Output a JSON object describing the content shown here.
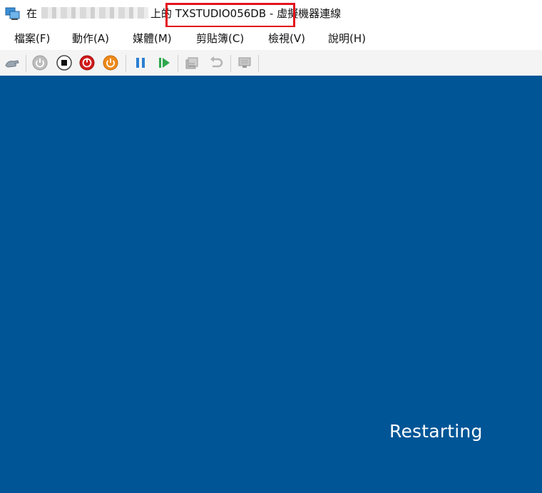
{
  "window": {
    "icon": "vm-connection-icon",
    "title_prefix": "在",
    "title_host": "TXSTUDIOXX RRM",
    "title_suffix": "上的 TXSTUDIO056DB - 虛擬機器連線",
    "vm_name": "TXSTUDIO056DB",
    "highlight_color": "#e3131b"
  },
  "menu": {
    "items": [
      {
        "label": "檔案(F)"
      },
      {
        "label": "動作(A)"
      },
      {
        "label": "媒體(M)"
      },
      {
        "label": "剪貼簿(C)"
      },
      {
        "label": "檢視(V)"
      },
      {
        "label": "說明(H)"
      }
    ]
  },
  "toolbar": {
    "buttons": [
      {
        "name": "ctrl-alt-del-icon"
      },
      {
        "name": "start-icon"
      },
      {
        "name": "turn-off-icon"
      },
      {
        "name": "shut-down-icon"
      },
      {
        "name": "save-icon"
      },
      {
        "name": "pause-icon"
      },
      {
        "name": "reset-icon"
      },
      {
        "name": "checkpoint-icon"
      },
      {
        "name": "revert-icon"
      },
      {
        "name": "enhanced-session-icon"
      }
    ]
  },
  "screen": {
    "background": "#005596",
    "status": "Restarting"
  }
}
